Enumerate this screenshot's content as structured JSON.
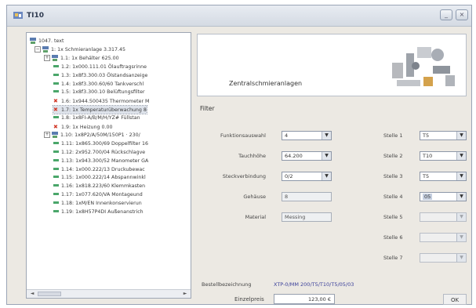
{
  "window": {
    "title": "TI10",
    "minimize_glyph": "_",
    "close_glyph": "×"
  },
  "tree": {
    "root_label": "1047. text",
    "nodes": [
      {
        "prefix": "minus",
        "icon": "node-icon",
        "label": "1: 1x Schmieranlage 3.317.45"
      },
      {
        "prefix": "plus",
        "icon": "node-icon",
        "label": "1.1: 1x Behälter 625.00"
      },
      {
        "prefix": "",
        "icon": "dash-icon",
        "label": "1.2: 1x000.111.01 Ölauftragsrinne"
      },
      {
        "prefix": "",
        "icon": "dash-icon",
        "label": "1.3: 1x8f3.300.03 Ölstandsanzeige"
      },
      {
        "prefix": "",
        "icon": "dash-icon",
        "label": "1.4: 1x8f3.300.60/60 Tankverschl"
      },
      {
        "prefix": "",
        "icon": "dash-icon",
        "label": "1.5: 1x8f3.300.10 Belüftungsfilter"
      },
      {
        "prefix": "",
        "icon": "x-icon",
        "label": "1.6: 1x944.500435 Thermometer M"
      },
      {
        "prefix": "",
        "icon": "x-icon",
        "label": "1.7: 1x Temperaturüberwachung 8",
        "selected": true
      },
      {
        "prefix": "",
        "icon": "dash-icon",
        "label": "1.8: 1x8FI-A/B/M/H/YZ# Füllstan"
      },
      {
        "prefix": "",
        "icon": "x-icon",
        "label": "1.9: 1x Heizung 0.00"
      },
      {
        "prefix": "plus",
        "icon": "node-icon",
        "label": "1.10: 1x8P2/A/50M/150P1 · 230/"
      },
      {
        "prefix": "",
        "icon": "dash-icon",
        "label": "1.11: 1x865.300/69 Doppelfilter 16"
      },
      {
        "prefix": "",
        "icon": "dash-icon",
        "label": "1.12: 2x952.700/04 Rückschlagve"
      },
      {
        "prefix": "",
        "icon": "dash-icon",
        "label": "1.13: 1x943.300/52 Manometer GA"
      },
      {
        "prefix": "",
        "icon": "dash-icon",
        "label": "1.14: 1x000.222/13 Druckubewac"
      },
      {
        "prefix": "",
        "icon": "dash-icon",
        "label": "1.15: 1x000.222/14 Abspannwinkl"
      },
      {
        "prefix": "",
        "icon": "dash-icon",
        "label": "1.16: 1x818.223/60 Klemmkasten"
      },
      {
        "prefix": "",
        "icon": "dash-icon",
        "label": "1.17: 1x077.620/VA Montageund"
      },
      {
        "prefix": "",
        "icon": "dash-icon",
        "label": "1.18: 1xM/EN Innenkonservierun"
      },
      {
        "prefix": "",
        "icon": "dash-icon",
        "label": "1.19: 1x8H57P4DI Außenanstrich"
      }
    ]
  },
  "banner": {
    "title": "Zentralschmieranlagen"
  },
  "filter": {
    "heading": "Filter",
    "fields": [
      {
        "label": "Funktionsauswahl",
        "value": "4",
        "type": "combo"
      },
      {
        "label": "Tauchhöhe",
        "value": "64.200",
        "type": "combo"
      },
      {
        "label": "Steckverbindung",
        "value": "0/2",
        "type": "combo"
      },
      {
        "label": "Gehäuse",
        "value": "8",
        "type": "text"
      },
      {
        "label": "Material",
        "value": "Messing",
        "type": "text"
      }
    ],
    "stellen": [
      {
        "label": "Stelle 1",
        "value": "T5"
      },
      {
        "label": "Stelle 2",
        "value": "T10"
      },
      {
        "label": "Stelle 3",
        "value": "T5"
      },
      {
        "label": "Stelle 4",
        "value": "05",
        "selected": true
      },
      {
        "label": "Stelle 5",
        "value": "",
        "disabled": true
      },
      {
        "label": "Stelle 6",
        "value": "",
        "disabled": true
      },
      {
        "label": "Stelle 7",
        "value": "",
        "disabled": true
      }
    ]
  },
  "footer": {
    "bezeichnung_label": "Bestellbezeichnung",
    "bezeichnung_value": "XTP-0/MM 200/T5/T10/T5/05/03",
    "price_label": "Einzelpreis",
    "price_value": "123,00 €",
    "ok_label": "OK"
  },
  "scroll": {
    "left_glyph": "◄",
    "right_glyph": "►"
  },
  "icons": {
    "app": "app-icon",
    "node": "node-icon",
    "ok_item": "dash-icon",
    "error_item": "x-icon",
    "dropdown": "chevron-down-icon"
  },
  "colors": {
    "accent": "#3a3f9a",
    "tree_ok": "#4aa66a",
    "tree_error": "#d23a2a"
  }
}
